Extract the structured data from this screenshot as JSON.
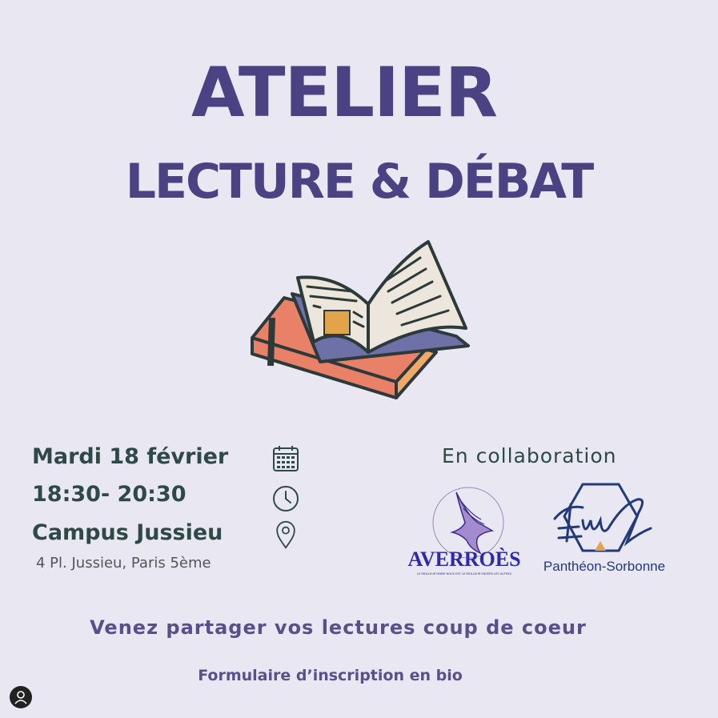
{
  "poster": {
    "title_line1": "ATELIER",
    "title_line2": "LECTURE & DÉBAT"
  },
  "event": {
    "date": "Mardi 18 février",
    "time": "18:30- 20:30",
    "place": "Campus Jussieu",
    "address": "4 Pl. Jussieu, Paris 5ème"
  },
  "icons": [
    "calendar-icon",
    "clock-icon",
    "location-pin-icon",
    "book-illustration",
    "profile-icon"
  ],
  "collaboration": {
    "label": "En collaboration",
    "partner1_name": "AVERROÈS",
    "partner1_tagline": "LE MEILLEUR PARMI NOUS EST LE MEILLEUR ENVERS LES AUTRES",
    "partner2_name": "Panthéon-Sorbonne"
  },
  "footer": {
    "invite": "Venez partager vos lectures coup de coeur",
    "signup": "Formulaire d’inscription en bio"
  },
  "colors": {
    "background": "#e8e7f2",
    "title": "#4b4283",
    "info_text": "#2f4a46",
    "footer_text": "#5a4f8a"
  }
}
